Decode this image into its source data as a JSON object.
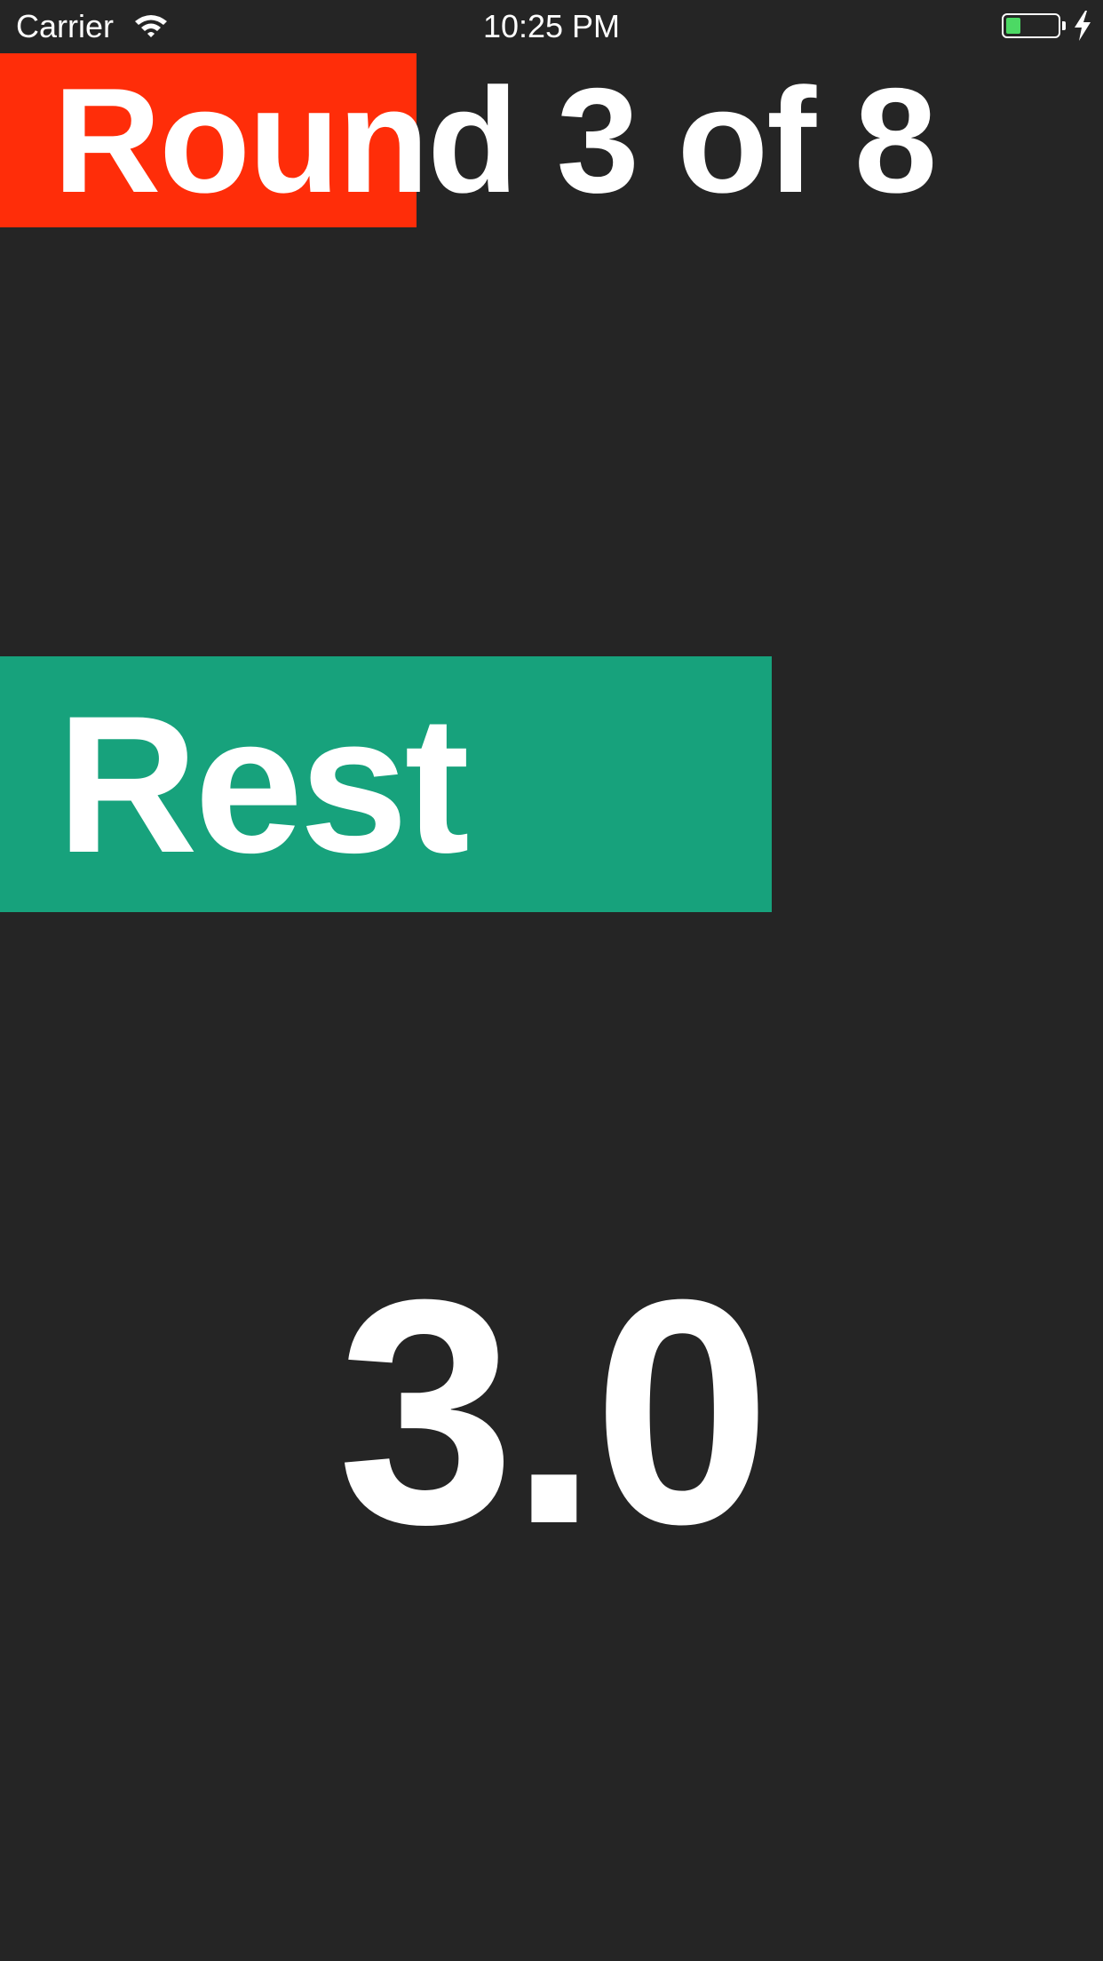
{
  "status_bar": {
    "carrier": "Carrier",
    "time": "10:25 PM",
    "battery_level": 0.28,
    "battery_color": "#4cd964",
    "charging": true,
    "wifi_icon": "wifi-icon",
    "charging_icon": "lightning-bolt-icon"
  },
  "round": {
    "label": "Round 3 of 8",
    "current": 3,
    "total": 8,
    "progress": 0.378,
    "color": "#ff2d09"
  },
  "phase": {
    "label": "Rest",
    "progress": 0.7,
    "color": "#17a27c"
  },
  "timer": {
    "value": "3.0"
  },
  "colors": {
    "background": "#252525",
    "text": "#ffffff"
  }
}
